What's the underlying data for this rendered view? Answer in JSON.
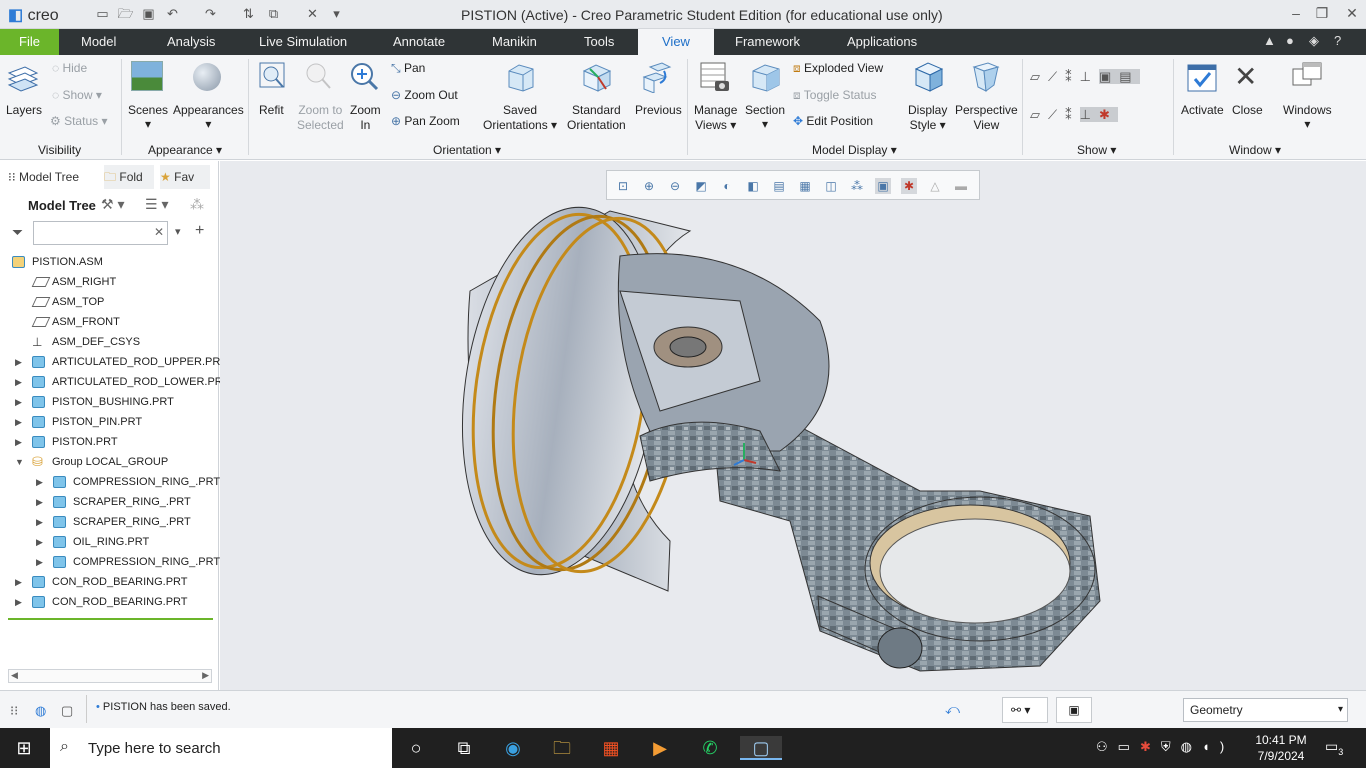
{
  "app": {
    "logo": "creo",
    "window_title": "PISTION (Active) - Creo Parametric Student Edition (for educational use only)"
  },
  "tabs": [
    "File",
    "Model",
    "Analysis",
    "Live Simulation",
    "Annotate",
    "Manikin",
    "Tools",
    "View",
    "Framework",
    "Applications"
  ],
  "active_tab": "View",
  "ribbon": {
    "visibility": {
      "layers": "Layers",
      "hide": "Hide",
      "show": "Show",
      "status": "Status",
      "group": "Visibility"
    },
    "appearance": {
      "scenes": "Scenes",
      "appearances": "Appearances",
      "group": "Appearance"
    },
    "orientation": {
      "refit": "Refit",
      "zoom_to_selected_1": "Zoom to",
      "zoom_to_selected_2": "Selected",
      "zoom_in_1": "Zoom",
      "zoom_in_2": "In",
      "pan": "Pan",
      "zoom_out": "Zoom Out",
      "pan_zoom": "Pan Zoom",
      "saved_1": "Saved",
      "saved_2": "Orientations",
      "standard_1": "Standard",
      "standard_2": "Orientation",
      "previous": "Previous",
      "group": "Orientation"
    },
    "model_display": {
      "manage_1": "Manage",
      "manage_2": "Views",
      "section": "Section",
      "exploded_view": "Exploded View",
      "toggle_status": "Toggle Status",
      "edit_position": "Edit Position",
      "display_1": "Display",
      "display_2": "Style",
      "perspective_1": "Perspective",
      "perspective_2": "View",
      "group": "Model Display"
    },
    "show": {
      "group": "Show"
    },
    "window": {
      "activate": "Activate",
      "close": "Close",
      "windows": "Windows",
      "group": "Window"
    }
  },
  "panel": {
    "tabs": [
      "Model Tree",
      "Fold",
      "Fav"
    ],
    "header": "Model Tree",
    "tree": [
      {
        "label": "PISTION.ASM",
        "type": "asm",
        "indent": 0,
        "arrow": ""
      },
      {
        "label": "ASM_RIGHT",
        "type": "datum",
        "indent": 1,
        "arrow": ""
      },
      {
        "label": "ASM_TOP",
        "type": "datum",
        "indent": 1,
        "arrow": ""
      },
      {
        "label": "ASM_FRONT",
        "type": "datum",
        "indent": 1,
        "arrow": ""
      },
      {
        "label": "ASM_DEF_CSYS",
        "type": "csys",
        "indent": 1,
        "arrow": ""
      },
      {
        "label": "ARTICULATED_ROD_UPPER.PRT",
        "type": "part",
        "indent": 1,
        "arrow": "▶"
      },
      {
        "label": "ARTICULATED_ROD_LOWER.PRT",
        "type": "part",
        "indent": 1,
        "arrow": "▶"
      },
      {
        "label": "PISTON_BUSHING.PRT",
        "type": "part",
        "indent": 1,
        "arrow": "▶"
      },
      {
        "label": "PISTON_PIN.PRT",
        "type": "part",
        "indent": 1,
        "arrow": "▶"
      },
      {
        "label": "PISTON.PRT",
        "type": "part",
        "indent": 1,
        "arrow": "▶"
      },
      {
        "label": "Group LOCAL_GROUP",
        "type": "group",
        "indent": 1,
        "arrow": "▼"
      },
      {
        "label": "COMPRESSION_RING_.PRT",
        "type": "part",
        "indent": 2,
        "arrow": "▶"
      },
      {
        "label": "SCRAPER_RING_.PRT",
        "type": "part",
        "indent": 2,
        "arrow": "▶"
      },
      {
        "label": "SCRAPER_RING_.PRT",
        "type": "part",
        "indent": 2,
        "arrow": "▶"
      },
      {
        "label": "OIL_RING.PRT",
        "type": "part",
        "indent": 2,
        "arrow": "▶"
      },
      {
        "label": "COMPRESSION_RING_.PRT",
        "type": "part",
        "indent": 2,
        "arrow": "▶"
      },
      {
        "label": "CON_ROD_BEARING.PRT",
        "type": "part",
        "indent": 1,
        "arrow": "▶"
      },
      {
        "label": "CON_ROD_BEARING.PRT",
        "type": "part",
        "indent": 1,
        "arrow": "▶"
      }
    ]
  },
  "status": {
    "message": "PISTION has been saved.",
    "filter": "Geometry"
  },
  "taskbar": {
    "search_placeholder": "Type here to search",
    "time": "10:41 PM",
    "date": "7/9/2024",
    "notifications": "3"
  }
}
